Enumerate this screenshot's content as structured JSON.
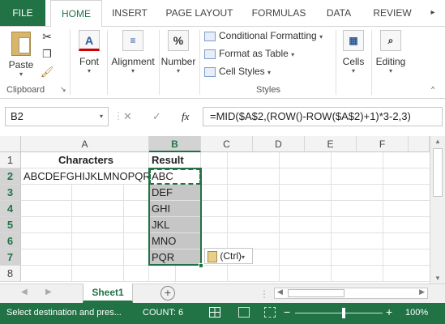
{
  "tabs": [
    "FILE",
    "HOME",
    "INSERT",
    "PAGE LAYOUT",
    "FORMULAS",
    "DATA",
    "REVIEW"
  ],
  "ribbon": {
    "paste": "Paste",
    "clipboard": "Clipboard",
    "font": "Font",
    "alignment": "Alignment",
    "number": "Number",
    "number_icon": "%",
    "font_icon": "A",
    "conditional_formatting": "Conditional Formatting",
    "format_as_table": "Format as Table",
    "cell_styles": "Cell Styles",
    "styles": "Styles",
    "cells": "Cells",
    "editing": "Editing"
  },
  "formula_bar": {
    "name_box": "B2",
    "fx": "fx",
    "cancel": "✕",
    "enter": "✓",
    "formula": "=MID($A$2,(ROW()-ROW($A$2)+1)*3-2,3)"
  },
  "columns": [
    "A",
    "B",
    "C",
    "D",
    "E",
    "F"
  ],
  "rows": [
    "1",
    "2",
    "3",
    "4",
    "5",
    "6",
    "7",
    "8"
  ],
  "cells": {
    "A1": "Characters",
    "B1": "Result",
    "A2": "ABCDEFGHIJKLMNOPQR",
    "B2": "ABC",
    "B3": "DEF",
    "B4": "GHI",
    "B5": "JKL",
    "B6": "MNO",
    "B7": "PQR"
  },
  "paste_options": "(Ctrl)",
  "sheet_tab": "Sheet1",
  "status": {
    "message": "Select destination and pres...",
    "count": "COUNT: 6",
    "zoom": "100%"
  },
  "colors": {
    "accent": "#217346",
    "selection": "#c6c6c6"
  }
}
